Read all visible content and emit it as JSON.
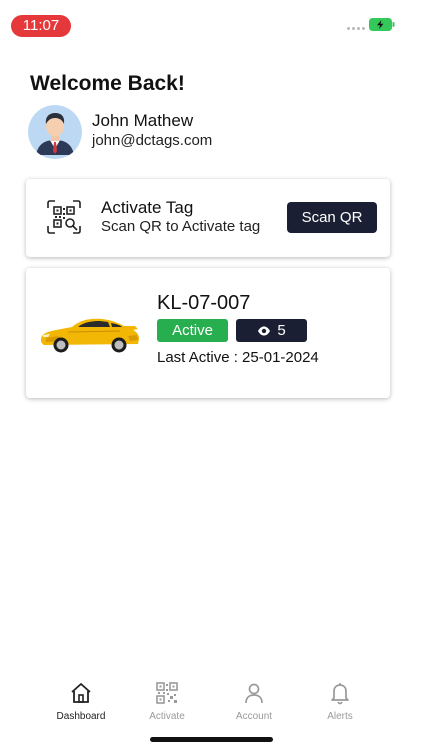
{
  "status_bar": {
    "time": "11:07"
  },
  "header": {
    "welcome": "Welcome Back!",
    "user_name": "John Mathew",
    "user_email": "john@dctags.com"
  },
  "activate_card": {
    "title": "Activate Tag",
    "subtitle": "Scan QR to Activate tag",
    "button_label": "Scan QR",
    "icon": "qr-scan-icon"
  },
  "vehicle_card": {
    "plate": "KL-07-007",
    "status": "Active",
    "views": "5",
    "last_active": "Last Active : 25-01-2024"
  },
  "tab_bar": {
    "tabs": [
      {
        "label": "Dashboard",
        "icon": "home-icon",
        "active": true
      },
      {
        "label": "Activate",
        "icon": "qr-icon",
        "active": false
      },
      {
        "label": "Account",
        "icon": "user-icon",
        "active": false
      },
      {
        "label": "Alerts",
        "icon": "bell-icon",
        "active": false
      }
    ]
  },
  "colors": {
    "time_pill": "#e5383b",
    "dark_button": "#1b1f33",
    "active_badge": "#27ae4f"
  }
}
